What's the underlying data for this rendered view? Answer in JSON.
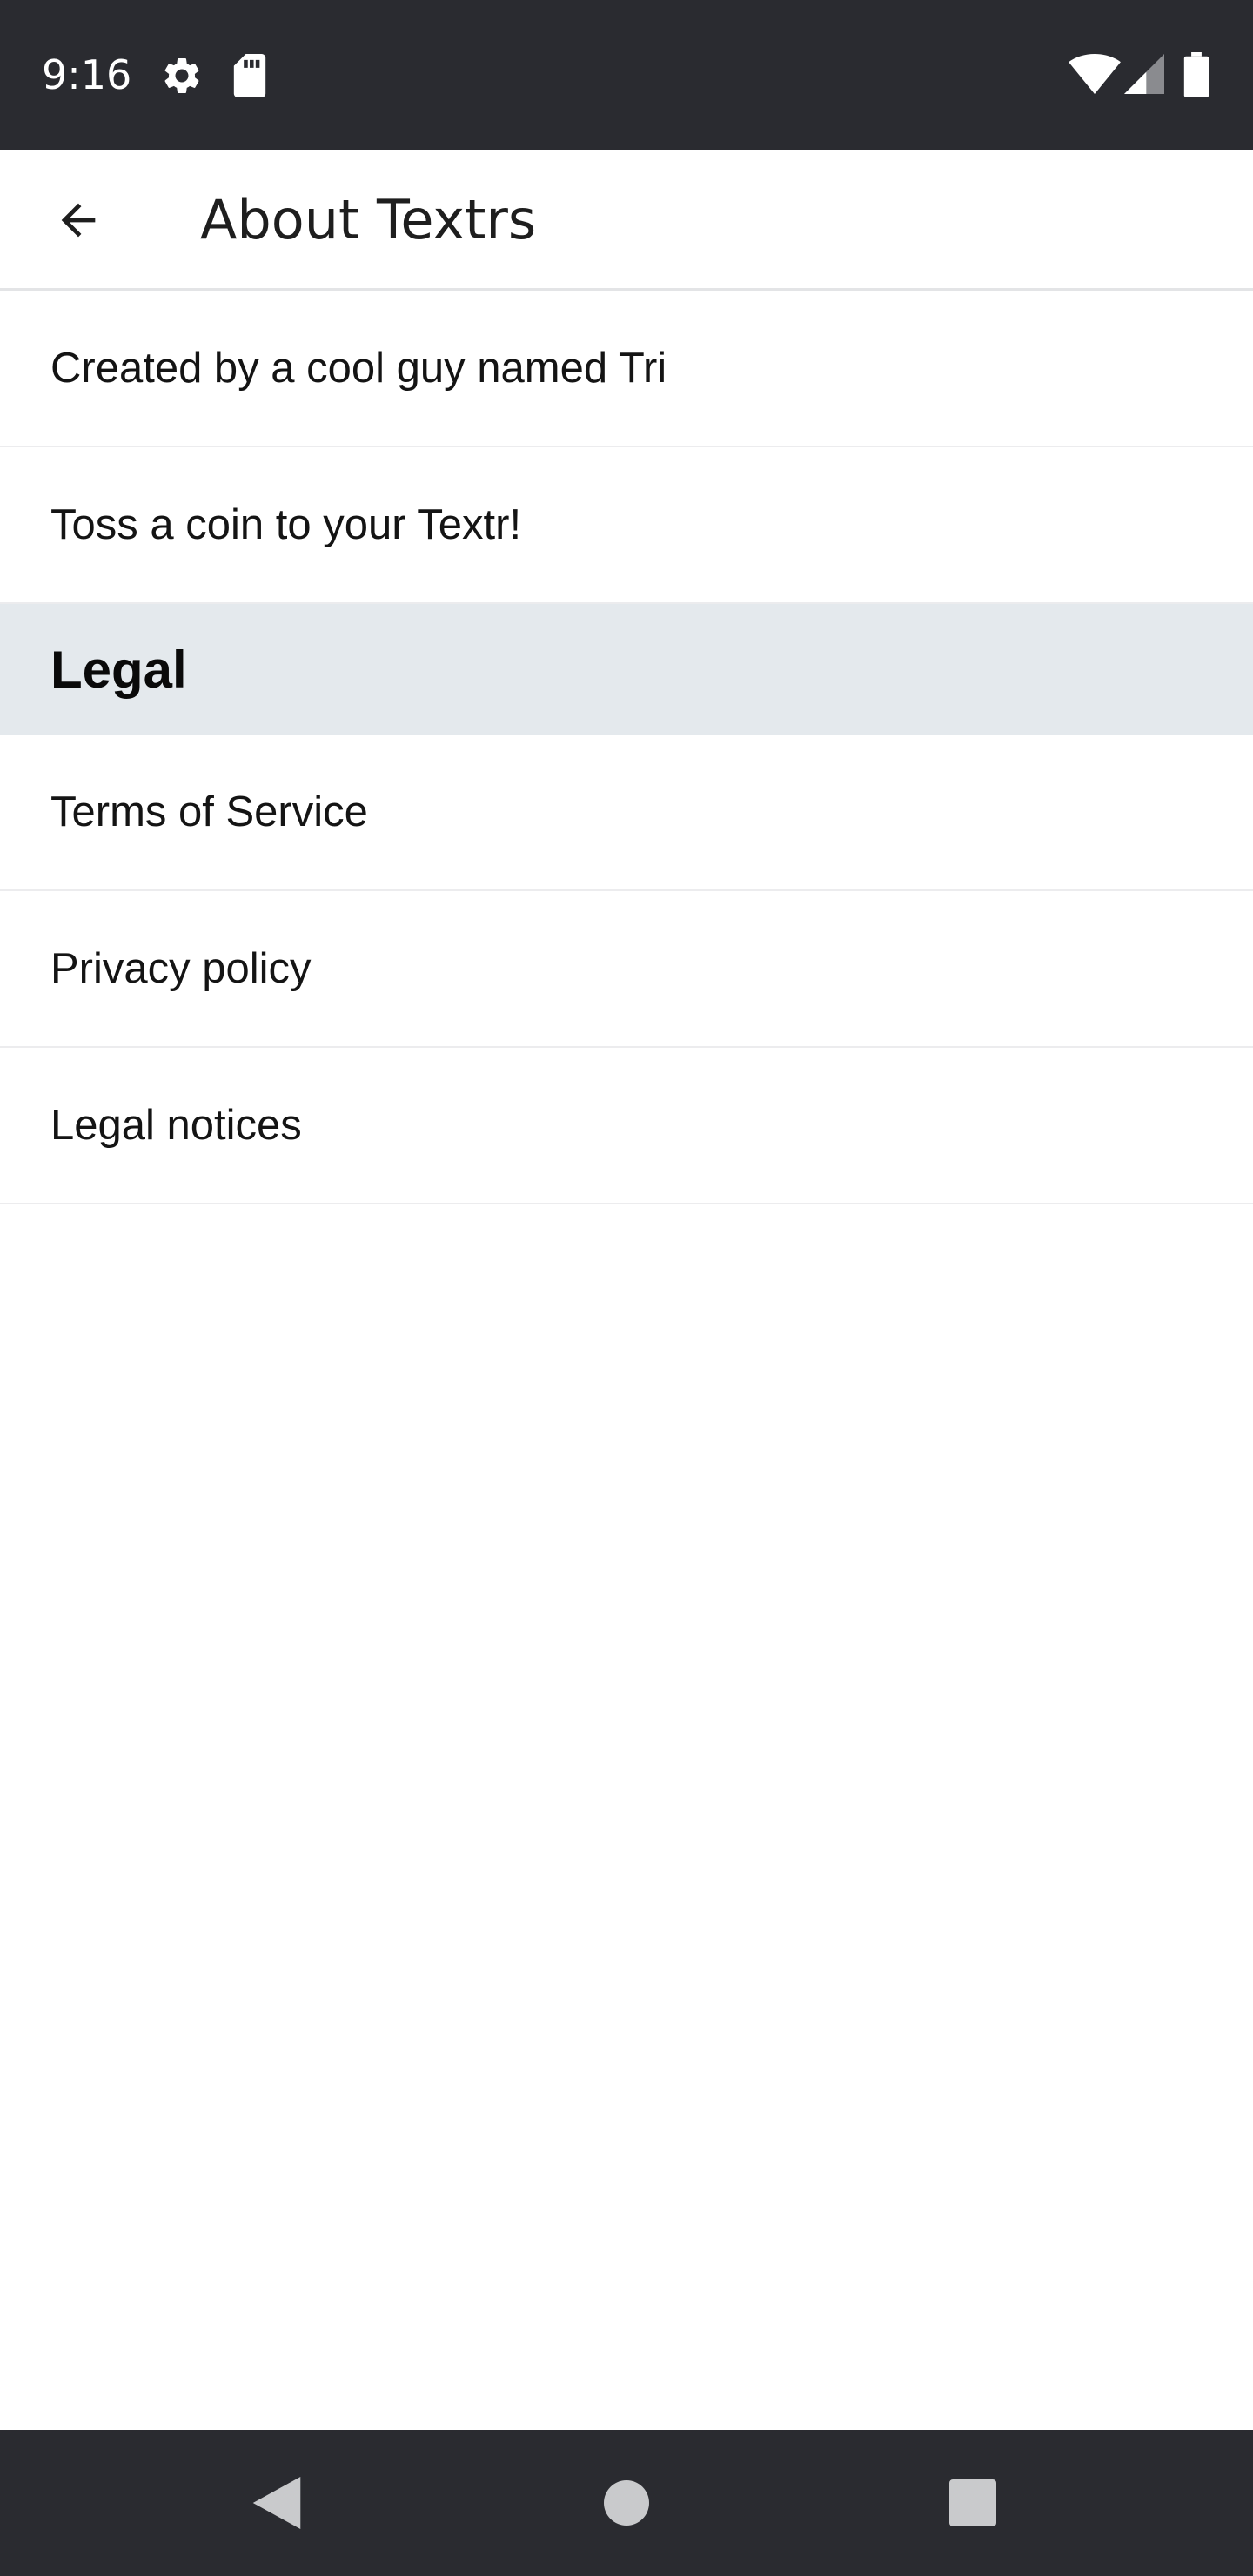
{
  "status_bar": {
    "time": "9:16",
    "icons": [
      "gear-icon",
      "sd-card-icon",
      "wifi-icon",
      "signal-icon",
      "battery-icon"
    ]
  },
  "app_bar": {
    "title": "About Textrs",
    "back_icon": "arrow-left-icon"
  },
  "items": [
    {
      "label": "Created by a cool guy named Tri"
    },
    {
      "label": "Toss a coin to your Textr!"
    }
  ],
  "legal_section": {
    "header": "Legal",
    "items": [
      {
        "label": "Terms of Service"
      },
      {
        "label": "Privacy policy"
      },
      {
        "label": "Legal notices"
      }
    ]
  },
  "nav_bar": {
    "icons": [
      "back-triangle-icon",
      "home-circle-icon",
      "recents-square-icon"
    ]
  },
  "colors": {
    "status_bar_bg": "#2a2b30",
    "section_header_bg": "#e4e9ed",
    "divider": "#ececee"
  }
}
